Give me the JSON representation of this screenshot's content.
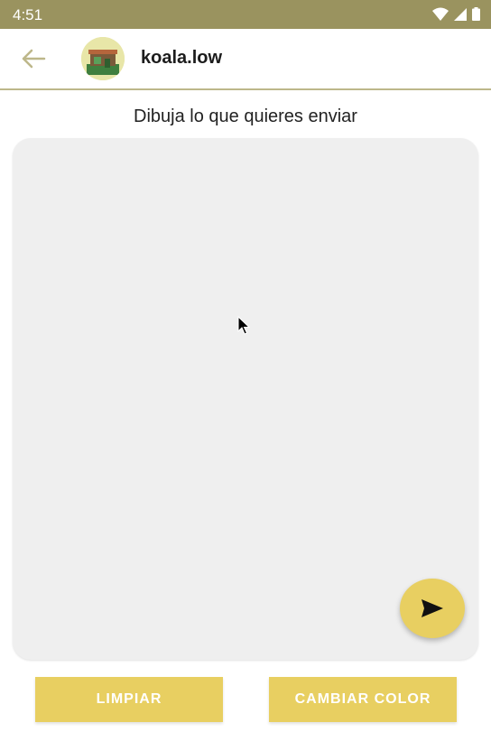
{
  "status_bar": {
    "time": "4:51",
    "icons": [
      "wifi-icon",
      "signal-icon",
      "battery-icon"
    ]
  },
  "app_bar": {
    "back_icon": "arrow-left-icon",
    "username": "koala.low"
  },
  "prompt": "Dibuja lo que quieres enviar",
  "canvas": {
    "send_icon": "send-icon"
  },
  "actions": {
    "clear_label": "LIMPIAR",
    "change_color_label": "CAMBIAR COLOR"
  },
  "colors": {
    "accent": "#e8cf61",
    "status_bar": "#9a935f",
    "canvas": "#efefef"
  }
}
